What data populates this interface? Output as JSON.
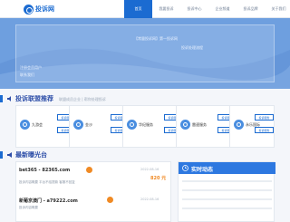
{
  "header": {
    "logo_text": "投诉网",
    "nav": [
      "首页",
      "我要投诉",
      "投诉中心",
      "企业频道",
      "投诉品牌",
      "关于我们"
    ]
  },
  "hero": {
    "line1": "【常量投诉网】第一投诉网",
    "line2": "注册会员用户",
    "line3": "联系我们",
    "line4": "投诉处理流程"
  },
  "partners": {
    "title": "投诉联盟推荐",
    "subtitle": "联盟成员企业 | 帮你处理投诉",
    "button_top": "投诉服务",
    "button_bottom": "投诉服务",
    "cards": [
      {
        "name": "九游会"
      },
      {
        "name": "金沙"
      },
      {
        "name": "华纪服务"
      },
      {
        "name": "雷速服务"
      },
      {
        "name": "永乐国际"
      }
    ]
  },
  "latest": {
    "title": "最新曝光台",
    "entries": [
      {
        "title": "bet365 - 82365.com",
        "date": "2022-08-16",
        "amount": "820 元",
        "text": "投诉内容概要 平台不给提款 客服不回复"
      },
      {
        "title": "新葡京澳门 - a79222.com",
        "date": "2022-08-16",
        "amount": "",
        "text": "投诉内容概要"
      }
    ]
  },
  "realtime": {
    "title": "实时动态"
  },
  "colors": {
    "brand": "#1b6bd1",
    "accent": "#f08a24",
    "hero_bg": "#6e9fdf"
  }
}
